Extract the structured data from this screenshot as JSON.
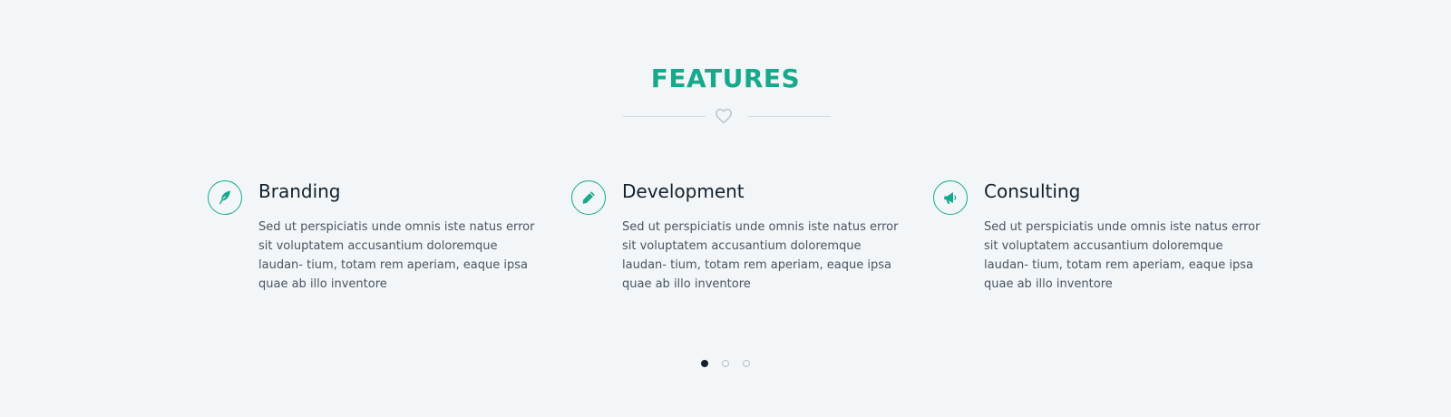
{
  "section": {
    "title": "FEATURES",
    "accent_color": "#17a98c",
    "divider_icon": "heart-icon"
  },
  "features": [
    {
      "icon": "feather-icon",
      "heading": "Branding",
      "description": "Sed ut perspiciatis unde omnis iste natus error sit voluptatem accusantium doloremque laudan- tium, totam rem aperiam, eaque ipsa quae ab illo inventore"
    },
    {
      "icon": "pencil-icon",
      "heading": "Development",
      "description": "Sed ut perspiciatis unde omnis iste natus error sit voluptatem accusantium doloremque laudan- tium, totam rem aperiam, eaque ipsa quae ab illo inventore"
    },
    {
      "icon": "megaphone-icon",
      "heading": "Consulting",
      "description": "Sed ut perspiciatis unde omnis iste natus error sit voluptatem accusantium doloremque laudan- tium, totam rem aperiam, eaque ipsa quae ab illo inventore"
    }
  ],
  "pagination": {
    "total": 3,
    "active_index": 0
  }
}
